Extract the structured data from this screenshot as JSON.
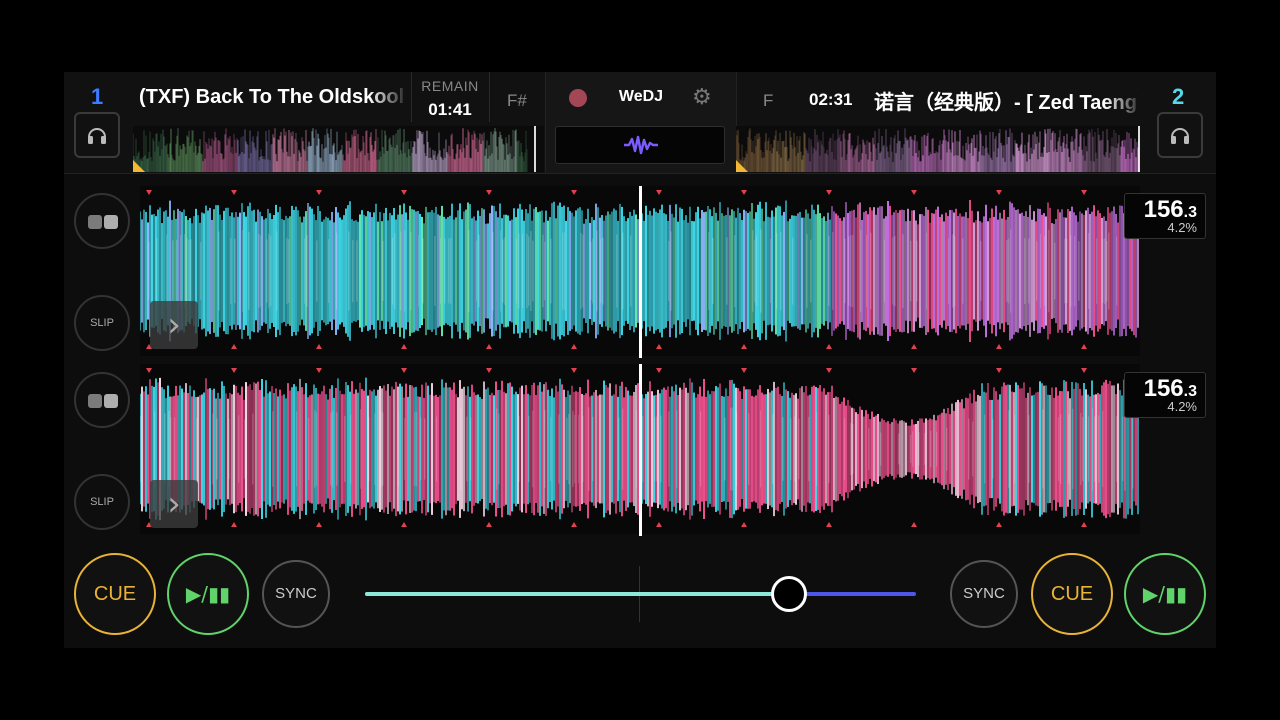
{
  "app": {
    "logo": "WeDJ"
  },
  "deck1": {
    "number": "1",
    "title": "(TXF) Back To The Oldskool",
    "remain_label": "REMAIN",
    "remain_time": "01:41",
    "key": "F#",
    "bpm_int": "156",
    "bpm_dec": ".3",
    "pitch": "4.2%",
    "overview_position": 0.98,
    "buttons": {
      "cue": "CUE",
      "play": "▶/▮▮",
      "sync": "SYNC",
      "slip": "SLIP"
    }
  },
  "deck2": {
    "number": "2",
    "title": "诺言（经典版）- [ Zed Taeng ]",
    "time": "02:31",
    "key": "F",
    "bpm_int": "156",
    "bpm_dec": ".3",
    "pitch": "4.2%",
    "overview_position": 1.0,
    "buttons": {
      "cue": "CUE",
      "play": "▶/▮▮",
      "sync": "SYNC",
      "slip": "SLIP"
    }
  },
  "crossfader": {
    "value": 0.77
  },
  "colors": {
    "deck1_accent": "#3d7bff",
    "deck2_accent": "#57d8ea",
    "cue": "#e8b336",
    "play": "#61d36b",
    "record": "#a34756",
    "beat_marker": "#e0414f",
    "wave_cyan": "#3fd8e8",
    "wave_pink": "#f0508f",
    "wave_purple": "#c070e0"
  },
  "icons": {
    "headphones": "headphones-icon",
    "gear": "gear-icon",
    "waveform": "waveform-icon",
    "record": "record-icon",
    "loop": "loop-icon",
    "chevron": "chevron-right-icon"
  }
}
